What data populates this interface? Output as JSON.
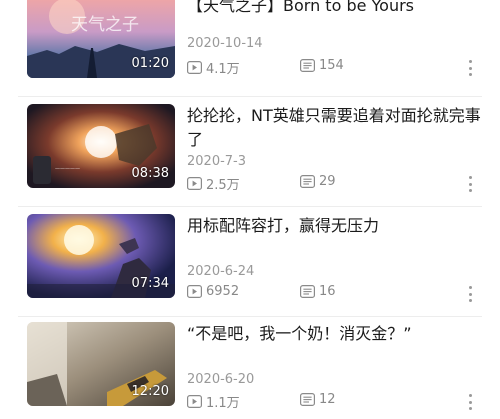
{
  "videos": [
    {
      "title": "【天气之子】Born  to  be  Yours",
      "duration": "01:20",
      "date": "2020-10-14",
      "plays": "4.1万",
      "danmaku": "154"
    },
    {
      "title": "抡抡抡，NT英雄只需要追着对面抡就完事了",
      "duration": "08:38",
      "date": "2020-7-3",
      "plays": "2.5万",
      "danmaku": "29"
    },
    {
      "title": "用标配阵容打，赢得无压力",
      "duration": "07:34",
      "date": "2020-6-24",
      "plays": "6952",
      "danmaku": "16"
    },
    {
      "title": "“不是吧，我一个奶！消灭金？”",
      "duration": "12:20",
      "date": "2020-6-20",
      "plays": "1.1万",
      "danmaku": "12"
    }
  ],
  "icons": {
    "plays": "play-count-icon",
    "danmaku": "danmaku-icon",
    "more": "more-vertical-icon"
  },
  "colors": {
    "meta_text": "#999999",
    "title_text": "#1b1b1b",
    "divider": "#ededed"
  }
}
